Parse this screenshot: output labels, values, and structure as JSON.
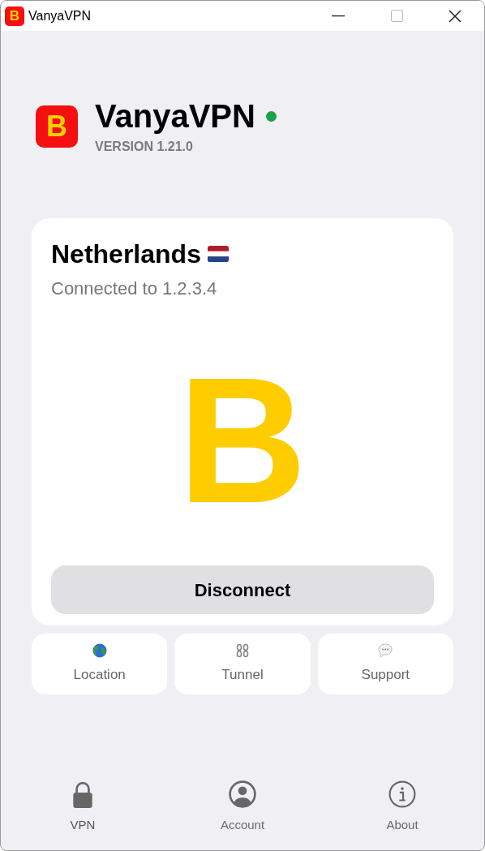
{
  "window": {
    "title": "VanyaVPN",
    "logo_letter": "B"
  },
  "header": {
    "logo_letter": "B",
    "app_name": "VanyaVPN",
    "connected": true,
    "version": "VERSION 1.21.0"
  },
  "connection": {
    "country": "Netherlands",
    "status_text": "Connected to 1.2.3.4",
    "logo_letter": "B",
    "button": "Disconnect"
  },
  "tiles": [
    {
      "kind": "globe",
      "label": "Location"
    },
    {
      "kind": "chain",
      "label": "Tunnel"
    },
    {
      "kind": "speech",
      "label": "Support"
    }
  ],
  "nav": [
    {
      "kind": "lock",
      "label": "VPN",
      "selected": true
    },
    {
      "kind": "account",
      "label": "Account",
      "selected": false
    },
    {
      "kind": "info",
      "label": "About",
      "selected": false
    }
  ]
}
